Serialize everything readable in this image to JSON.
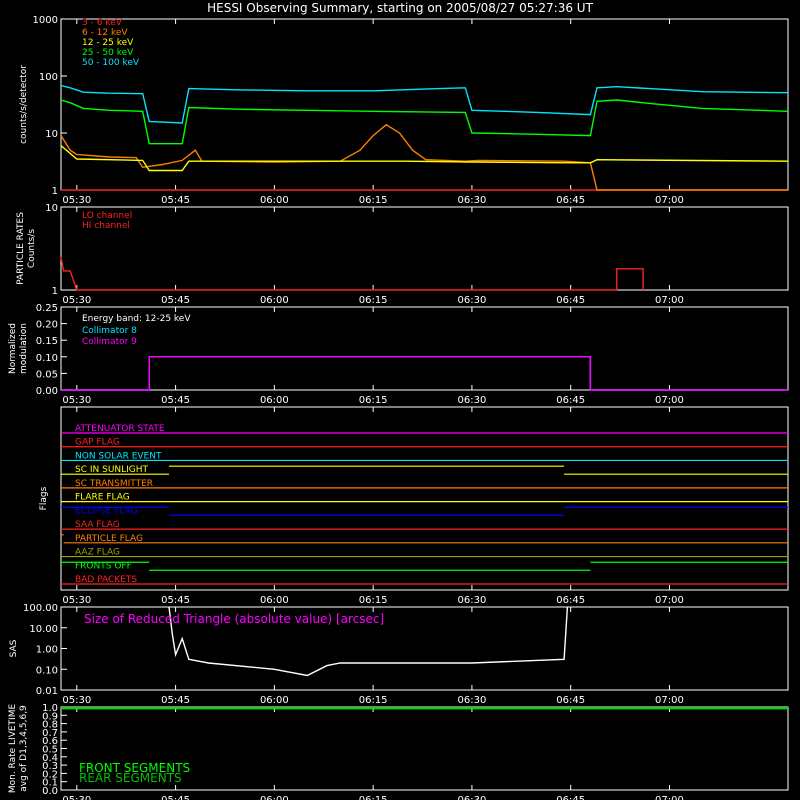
{
  "title": "HESSI Observing Summary, starting on 2005/08/27 05:27:36 UT",
  "time_axis": {
    "start": "05:27:36",
    "end": "07:18",
    "ticks": [
      "05:30",
      "05:45",
      "06:00",
      "06:15",
      "06:30",
      "06:45",
      "07:00"
    ]
  },
  "colors": {
    "bg": "#000000",
    "frame": "#ffffff",
    "c3_6": "#ff2020",
    "c6_12": "#ff7f00",
    "c12_25": "#ffff00",
    "c25_50": "#00ff00",
    "c50_100": "#00e5ff",
    "magenta": "#ff00ff",
    "blue": "#0000ff",
    "olive": "#a0a000",
    "green2": "#00c000"
  },
  "chart_data": [
    {
      "id": "count-rates",
      "type": "line",
      "ylabel": "counts/s/detector",
      "yscale": "log",
      "ylim": [
        1,
        1000
      ],
      "yticks": [
        "1",
        "10",
        "100",
        "1000"
      ],
      "legend_position": "top-left",
      "series": [
        {
          "name": "3 - 6 keV",
          "color_key": "c3_6",
          "points": [
            [
              "05:27:36",
              1.0
            ],
            [
              "05:40",
              1.0
            ],
            [
              "05:45",
              1.0
            ],
            [
              "06:30",
              1.0
            ],
            [
              "06:45",
              1.0
            ],
            [
              "07:18",
              1.0
            ]
          ]
        },
        {
          "name": "6 - 12 keV",
          "color_key": "c6_12",
          "points": [
            [
              "05:27:36",
              9
            ],
            [
              "05:29",
              5
            ],
            [
              "05:30",
              4.2
            ],
            [
              "05:35",
              3.8
            ],
            [
              "05:39",
              3.7
            ],
            [
              "05:40",
              2.5
            ],
            [
              "05:43",
              2.8
            ],
            [
              "05:46",
              3.3
            ],
            [
              "05:48",
              5
            ],
            [
              "05:49",
              3.2
            ],
            [
              "06:00",
              3.1
            ],
            [
              "06:10",
              3.2
            ],
            [
              "06:13",
              5
            ],
            [
              "06:15",
              9
            ],
            [
              "06:17",
              14
            ],
            [
              "06:19",
              10
            ],
            [
              "06:21",
              5
            ],
            [
              "06:23",
              3.4
            ],
            [
              "06:29",
              3.2
            ],
            [
              "06:31",
              3.3
            ],
            [
              "06:44",
              3.2
            ],
            [
              "06:48",
              3.0
            ],
            [
              "06:49",
              1.0
            ],
            [
              "07:18",
              1.0
            ]
          ]
        },
        {
          "name": "12 - 25 keV",
          "color_key": "c12_25",
          "points": [
            [
              "05:27:36",
              6
            ],
            [
              "05:30",
              3.5
            ],
            [
              "05:40",
              3.3
            ],
            [
              "05:41",
              2.2
            ],
            [
              "05:46",
              2.2
            ],
            [
              "05:47",
              3.2
            ],
            [
              "06:20",
              3.2
            ],
            [
              "06:30",
              3.1
            ],
            [
              "06:45",
              3.0
            ],
            [
              "06:48",
              3.0
            ],
            [
              "06:49",
              3.4
            ],
            [
              "07:18",
              3.2
            ]
          ]
        },
        {
          "name": "25 - 50 keV",
          "color_key": "c25_50",
          "points": [
            [
              "05:27:36",
              38
            ],
            [
              "05:29",
              34
            ],
            [
              "05:31",
              27
            ],
            [
              "05:35",
              25
            ],
            [
              "05:40",
              24
            ],
            [
              "05:41",
              6.5
            ],
            [
              "05:46",
              6.5
            ],
            [
              "05:47",
              28
            ],
            [
              "05:55",
              26
            ],
            [
              "06:05",
              25
            ],
            [
              "06:15",
              24
            ],
            [
              "06:29",
              23
            ],
            [
              "06:30",
              10
            ],
            [
              "06:40",
              9.5
            ],
            [
              "06:48",
              9
            ],
            [
              "06:49",
              36
            ],
            [
              "06:52",
              38
            ],
            [
              "06:57",
              33
            ],
            [
              "07:05",
              27
            ],
            [
              "07:18",
              24
            ]
          ]
        },
        {
          "name": "50 - 100 keV",
          "color_key": "c50_100",
          "points": [
            [
              "05:27:36",
              68
            ],
            [
              "05:29",
              62
            ],
            [
              "05:31",
              52
            ],
            [
              "05:35",
              50
            ],
            [
              "05:40",
              49
            ],
            [
              "05:41",
              16
            ],
            [
              "05:46",
              15
            ],
            [
              "05:47",
              60
            ],
            [
              "05:55",
              57
            ],
            [
              "06:05",
              55
            ],
            [
              "06:15",
              55
            ],
            [
              "06:25",
              60
            ],
            [
              "06:29",
              62
            ],
            [
              "06:30",
              25
            ],
            [
              "06:40",
              23
            ],
            [
              "06:48",
              21
            ],
            [
              "06:49",
              62
            ],
            [
              "06:52",
              65
            ],
            [
              "06:57",
              60
            ],
            [
              "07:05",
              53
            ],
            [
              "07:18",
              51
            ]
          ]
        }
      ]
    },
    {
      "id": "particle-rates",
      "type": "line",
      "ylabel": "PARTICLE RATES Counts/s",
      "yscale": "log",
      "ylim": [
        1,
        10
      ],
      "yticks": [
        "1",
        "10"
      ],
      "legend_position": "top-left",
      "series": [
        {
          "name": "LO channel",
          "color_key": "c3_6",
          "points": []
        },
        {
          "name": "HI channel",
          "color_key": "c3_6",
          "points": [
            [
              "05:27:36",
              2.5
            ],
            [
              "05:28",
              1.7
            ],
            [
              "05:29",
              1.7
            ],
            [
              "05:30",
              1.0
            ],
            [
              "06:52",
              1.0
            ],
            [
              "06:52",
              1.8
            ],
            [
              "06:56",
              1.8
            ],
            [
              "06:56",
              1.0
            ]
          ]
        }
      ]
    },
    {
      "id": "modulation",
      "type": "line",
      "ylabel": "Normalized modulation",
      "ylim": [
        0,
        0.25
      ],
      "yticks": [
        "0.00",
        "0.05",
        "0.10",
        "0.15",
        "0.20",
        "0.25"
      ],
      "legend_position": "top-left",
      "band_label": "Energy band: 12-25 keV",
      "series": [
        {
          "name": "Collimator 8",
          "color_key": "c50_100",
          "points": [
            [
              "05:27:36",
              0
            ],
            [
              "05:41",
              0
            ],
            [
              "05:41",
              0.1
            ],
            [
              "06:48",
              0.1
            ],
            [
              "06:48",
              0
            ],
            [
              "07:18",
              0
            ]
          ]
        },
        {
          "name": "Collimator 9",
          "color_key": "magenta",
          "points": [
            [
              "05:27:36",
              0
            ],
            [
              "05:41",
              0
            ],
            [
              "05:41",
              0.1
            ],
            [
              "06:48",
              0.1
            ],
            [
              "06:48",
              0
            ],
            [
              "07:18",
              0
            ]
          ]
        }
      ]
    },
    {
      "id": "flags",
      "type": "line",
      "ylabel": "Flags",
      "series": [
        {
          "name": "ATTENUATOR STATE",
          "color_key": "magenta",
          "segments": [
            [
              "05:27:36",
              "07:18",
              0
            ]
          ]
        },
        {
          "name": "GAP FLAG",
          "color_key": "c3_6",
          "segments": [
            [
              "05:27:36",
              "07:18",
              0
            ]
          ]
        },
        {
          "name": "NON SOLAR EVENT",
          "color_key": "c50_100",
          "segments": [
            [
              "05:27:36",
              "07:18",
              0
            ]
          ]
        },
        {
          "name": "SC IN SUNLIGHT",
          "color_key": "c12_25",
          "segments": [
            [
              "05:27:36",
              "05:44",
              0
            ],
            [
              "05:44",
              "06:44",
              1
            ],
            [
              "06:44",
              "07:18",
              0
            ]
          ]
        },
        {
          "name": "SC TRANSMITTER",
          "color_key": "c6_12",
          "segments": [
            [
              "05:27:36",
              "07:18",
              0
            ]
          ]
        },
        {
          "name": "FLARE FLAG",
          "color_key": "c12_25",
          "segments": [
            [
              "05:27:36",
              "07:18",
              0
            ]
          ]
        },
        {
          "name": "ECLIPSE FLAG",
          "color_key": "blue",
          "segments": [
            [
              "05:27:36",
              "05:44",
              1
            ],
            [
              "05:44",
              "06:44",
              0
            ],
            [
              "06:44",
              "07:18",
              1
            ]
          ]
        },
        {
          "name": "SAA FLAG",
          "color_key": "c3_6",
          "segments": [
            [
              "05:27:36",
              "07:18",
              0
            ]
          ]
        },
        {
          "name": "PARTICLE FLAG",
          "color_key": "c6_12",
          "segments": [
            [
              "05:27:36",
              "05:28",
              1
            ],
            [
              "05:28",
              "07:18",
              0
            ]
          ]
        },
        {
          "name": "AAZ FLAG",
          "color_key": "olive",
          "segments": [
            [
              "05:27:36",
              "07:18",
              0
            ]
          ]
        },
        {
          "name": "FRONTS OFF",
          "color_key": "c25_50",
          "segments": [
            [
              "05:27:36",
              "05:41",
              1
            ],
            [
              "05:41",
              "06:48",
              0
            ],
            [
              "06:48",
              "07:18",
              1
            ]
          ]
        },
        {
          "name": "BAD PACKETS",
          "color_key": "c3_6",
          "segments": [
            [
              "05:27:36",
              "07:18",
              0
            ]
          ]
        }
      ]
    },
    {
      "id": "sas",
      "type": "line",
      "ylabel": "SAS",
      "yscale": "log",
      "ylim": [
        0.01,
        100
      ],
      "yticks": [
        "0.01",
        "0.10",
        "1.00",
        "10.00",
        "100.00"
      ],
      "annotation": "Size of Reduced Triangle (absolute value) [arcsec]",
      "series": [
        {
          "name": "",
          "color_key": "frame",
          "points": [
            [
              "05:44",
              100
            ],
            [
              "05:44:30",
              5
            ],
            [
              "05:45",
              0.5
            ],
            [
              "05:46",
              3
            ],
            [
              "05:47",
              0.3
            ],
            [
              "05:50",
              0.2
            ],
            [
              "06:00",
              0.1
            ],
            [
              "06:05",
              0.05
            ],
            [
              "06:08",
              0.15
            ],
            [
              "06:10",
              0.2
            ],
            [
              "06:30",
              0.2
            ],
            [
              "06:44",
              0.3
            ],
            [
              "06:44:30",
              100
            ]
          ]
        }
      ]
    },
    {
      "id": "livetime",
      "type": "line",
      "ylabel": "Mon. Rate LIVETIME avg of D1,3,4,5,6,9",
      "ylim": [
        0,
        1
      ],
      "yticks": [
        "0.0",
        "0.1",
        "0.2",
        "0.3",
        "0.4",
        "0.5",
        "0.6",
        "0.7",
        "0.8",
        "0.9",
        "1.0"
      ],
      "series": [
        {
          "name": "FRONT SEGMENTS",
          "color_key": "c25_50",
          "points": [
            [
              "05:27:36",
              0.98
            ],
            [
              "07:18",
              0.98
            ]
          ]
        },
        {
          "name": "REAR SEGMENTS",
          "color_key": "green2",
          "points": [
            [
              "05:27:36",
              0.99
            ],
            [
              "07:18",
              0.99
            ]
          ]
        }
      ]
    }
  ]
}
